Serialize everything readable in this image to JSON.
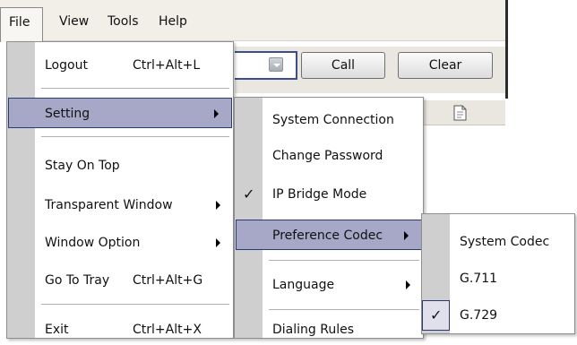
{
  "menubar": {
    "items": [
      "File",
      "View",
      "Tools",
      "Help"
    ]
  },
  "toolbar": {
    "call_label": "Call",
    "clear_label": "Clear"
  },
  "file_menu": {
    "items": [
      {
        "label": "Logout",
        "shortcut": "Ctrl+Alt+L"
      },
      {
        "label": "Setting",
        "submenu": true,
        "highlighted": true
      },
      {
        "label": "Stay On Top"
      },
      {
        "label": "Transparent Window",
        "submenu": true
      },
      {
        "label": "Window Option",
        "submenu": true
      },
      {
        "label": "Go To Tray",
        "shortcut": "Ctrl+Alt+G"
      },
      {
        "label": "Exit",
        "shortcut": "Ctrl+Alt+X"
      }
    ]
  },
  "setting_menu": {
    "items": [
      {
        "label": "System Connection"
      },
      {
        "label": "Change Password"
      },
      {
        "label": "IP Bridge Mode",
        "checked": true
      },
      {
        "label": "Preference Codec",
        "submenu": true,
        "highlighted": true
      },
      {
        "label": "Language",
        "submenu": true
      },
      {
        "label": "Dialing Rules"
      }
    ]
  },
  "codec_menu": {
    "items": [
      {
        "label": "System Codec"
      },
      {
        "label": "G.711"
      },
      {
        "label": "G.729",
        "checked": true
      }
    ]
  },
  "icons": {
    "check": "✓"
  },
  "colors": {
    "highlight": "#a7a8c8",
    "highlight_border": "#293a7a",
    "gutter": "#cfcfcf"
  }
}
